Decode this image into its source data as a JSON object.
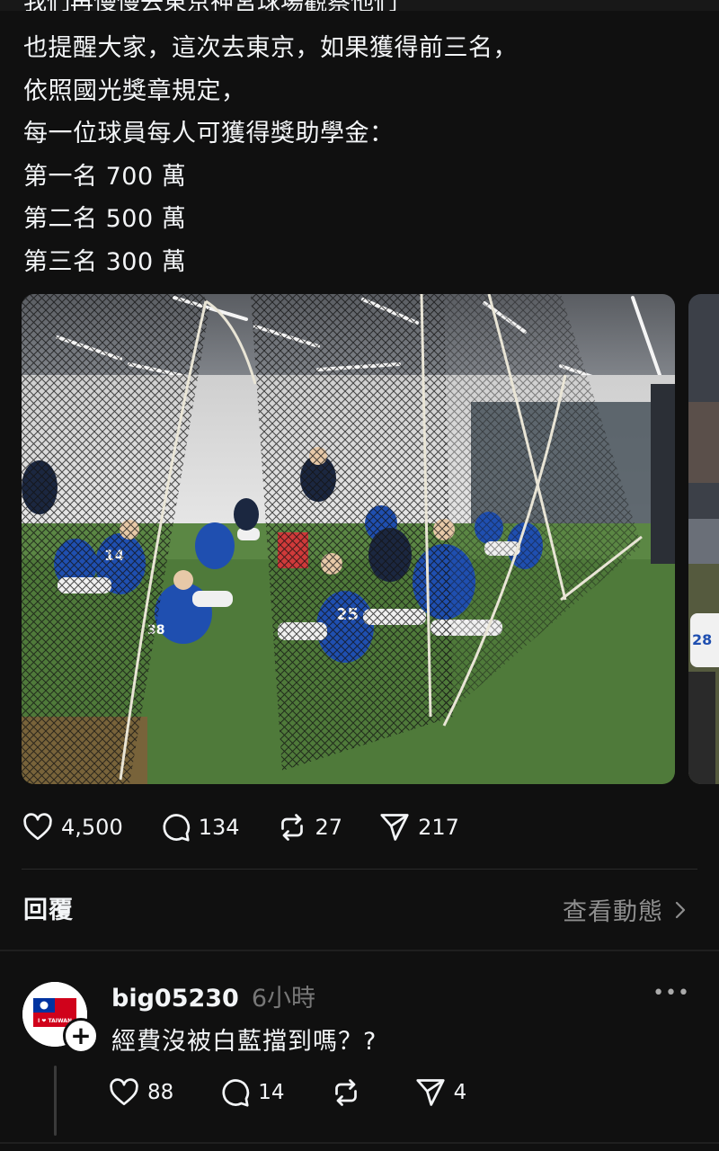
{
  "post": {
    "top_cut_text": "我們再慢慢去東京神宮球場觀察他們",
    "lines": [
      "也提醒大家，這次去東京，如果獲得前三名，",
      "依照國光獎章規定，",
      "每一位球員每人可獲得獎助學金：",
      "第一名 700 萬",
      "第二名 500 萬",
      "第三名 300 萬"
    ],
    "likes": "4,500",
    "comments": "134",
    "reposts": "27",
    "shares": "217"
  },
  "replies": {
    "title": "回覆",
    "activity_label": "查看動態"
  },
  "comment": {
    "username": "big05230",
    "time": "6小時",
    "more": "•••",
    "text": "經費沒被白藍擋到嗎？?",
    "avatar_text": "I ❤ TAIWAN",
    "likes": "88",
    "replies": "14",
    "reposts": "",
    "shares": "4"
  },
  "colors": {
    "background": "#101010",
    "text": "#f3f5f7",
    "muted": "#8e8e8e",
    "turf": "#4f7a3a",
    "jersey": "#1f4fb0"
  },
  "icons": [
    "heart-icon",
    "comment-icon",
    "repost-icon",
    "share-icon",
    "chevron-right-icon",
    "more-icon",
    "plus-icon"
  ]
}
